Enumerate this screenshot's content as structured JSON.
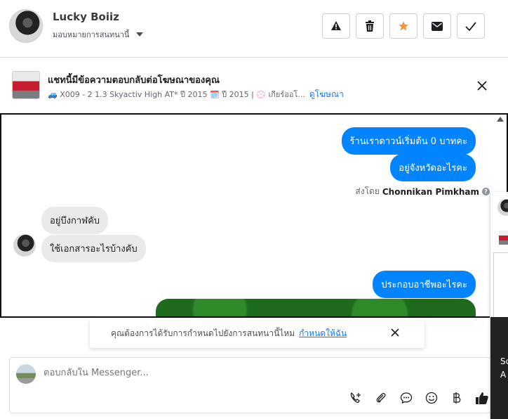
{
  "header": {
    "user_name": "Lucky Boiiz",
    "assign_label": "มอบหมายการสนทนานี้",
    "actions": [
      {
        "name": "report",
        "icon": "warning-icon"
      },
      {
        "name": "delete",
        "icon": "trash-icon"
      },
      {
        "name": "star",
        "icon": "star-icon",
        "color": "#f7923b"
      },
      {
        "name": "mark-unread",
        "icon": "envelope-icon"
      },
      {
        "name": "done",
        "icon": "check-icon"
      }
    ]
  },
  "ad": {
    "title": "แชทนี้มีข้อความตอบกลับต่อโฆษณาของคุณ",
    "subtitle": "🚙 X009 - 2 1.3 Skyactiv High AT* ปี 2015 🗓️ ปี 2015 | 💮 เกียร์ออโ...",
    "link": "ดูโฆษณา"
  },
  "messages": {
    "outgoing": [
      "ร้านเราดาวน์เริ่มต้น 0 บาทคะ",
      "อยู่จังหวัดอะไรคะ",
      "ประกอบอาชีพอะไรคะ"
    ],
    "sent_by_label": "ส่งโดย",
    "sent_by_name": "Chonnikan Pimkham",
    "incoming": [
      "อยู่บึงกาฬคับ",
      "ใช้เอกสารอะไรบ้างคับ"
    ]
  },
  "prompt": {
    "text": "คุณต้องการได้รับการกำหนดไปยังการสนทนานี้ไหม",
    "link": "กำหนดให้ฉัน"
  },
  "composer": {
    "placeholder": "ตอบกลับใน Messenger...",
    "tools": [
      "call-add-icon",
      "attachment-icon",
      "saved-reply-icon",
      "emoji-icon",
      "baht-icon",
      "like-icon"
    ]
  },
  "side": {
    "text_1": "Sc",
    "text_2": "A"
  },
  "colors": {
    "brand_blue": "#0084ff",
    "link_blue": "#1877f2",
    "star_orange": "#f7923b"
  }
}
